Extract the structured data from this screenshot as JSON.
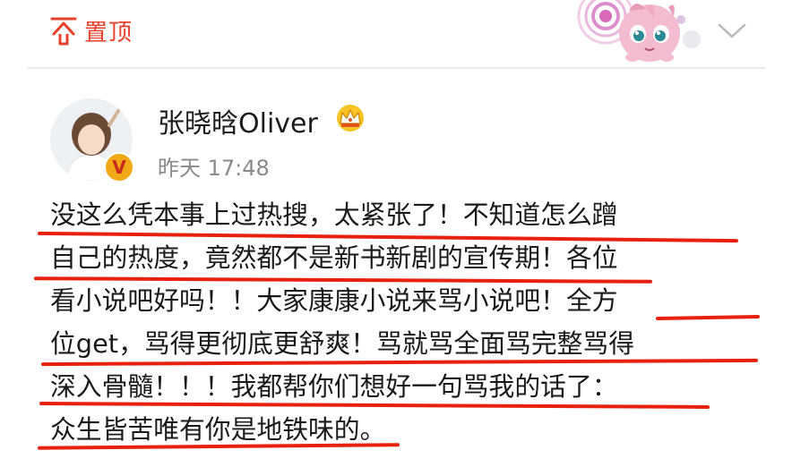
{
  "top_bar": {
    "pin_label": "置顶",
    "pin_icon": "pin-top-icon",
    "expand_icon": "chevron-down-icon",
    "sticker": "jigglypuff-sticker",
    "accent_color": "#e8402b"
  },
  "post": {
    "author": "张晓晗Oliver",
    "verified_badge": "V",
    "vip_icon": "crown-icon",
    "time": "昨天 17:48",
    "lines": [
      "没这么凭本事上过热搜，太紧张了！不知道怎么蹭",
      "自己的热度，竟然都不是新书新剧的宣传期！各位",
      "看小说吧好吗！！大家康康小说来骂小说吧！全方",
      "位get，骂得更彻底更舒爽！骂就骂全面骂完整骂得",
      "深入骨髓！！！我都帮你们想好一句骂我的话了：",
      "众生皆苦唯有你是地铁味的。"
    ],
    "highlight_color": "#e8210f"
  }
}
